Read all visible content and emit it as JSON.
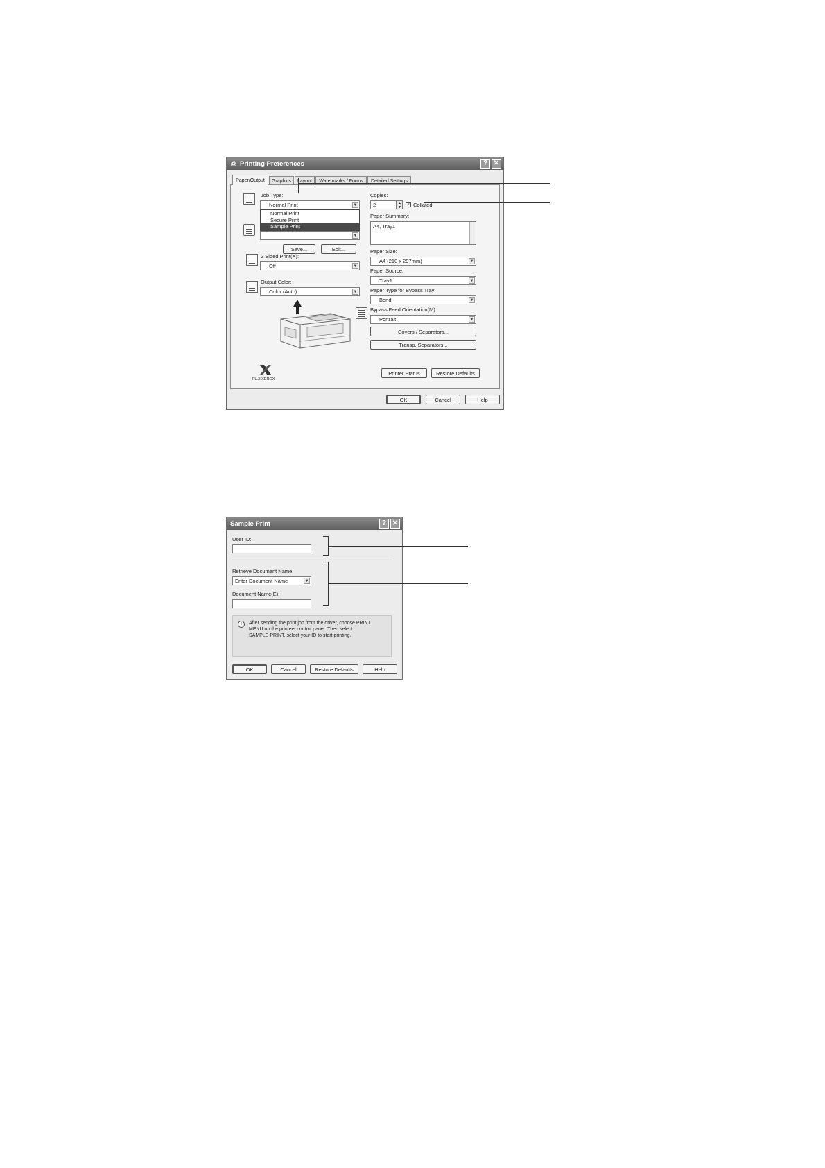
{
  "printing_preferences": {
    "title": "Printing Preferences",
    "tabs": [
      "Paper/Output",
      "Graphics",
      "Layout",
      "Watermarks / Forms",
      "Detailed Settings"
    ],
    "job_type": {
      "label": "Job Type:",
      "value": "Normal Print",
      "options": [
        "Normal Print",
        "Secure Print",
        "Sample Print"
      ]
    },
    "save_label": "Save...",
    "edit_label": "Edit...",
    "two_sided": {
      "label": "2 Sided Print(X):",
      "value": "Off"
    },
    "output_color": {
      "label": "Output Color:",
      "value": "Color (Auto)"
    },
    "copies": {
      "label": "Copies:",
      "value": "2",
      "collated_label": "Collated"
    },
    "paper_summary": {
      "label": "Paper Summary:",
      "value": "A4, Tray1"
    },
    "paper_size": {
      "label": "Paper Size:",
      "value": "A4 (210 x 297mm)"
    },
    "paper_source": {
      "label": "Paper Source:",
      "value": "Tray1"
    },
    "paper_type_bypass": {
      "label": "Paper Type for Bypass Tray:",
      "value": "Bond"
    },
    "bypass_orientation": {
      "label": "Bypass Feed Orientation(M):",
      "value": "Portrait"
    },
    "covers_label": "Covers / Separators...",
    "transp_label": "Transp. Separators...",
    "printer_status_label": "Printer Status",
    "restore_defaults_label": "Restore Defaults",
    "brand": "FUJI XEROX",
    "ok_label": "OK",
    "cancel_label": "Cancel",
    "help_label": "Help"
  },
  "sample_print": {
    "title": "Sample Print",
    "user_id_label": "User ID:",
    "user_id_value": "",
    "retrieve_label": "Retrieve Document Name:",
    "retrieve_value": "Enter Document Name",
    "doc_name_label": "Document Name(E):",
    "doc_name_value": "",
    "info_line1": "After sending the print job from the driver, choose PRINT",
    "info_line2": "MENU on the printers control panel.  Then select",
    "info_line3": "SAMPLE PRINT, select your ID to start printing.",
    "ok_label": "OK",
    "cancel_label": "Cancel",
    "restore_defaults_label": "Restore Defaults",
    "help_label": "Help"
  }
}
